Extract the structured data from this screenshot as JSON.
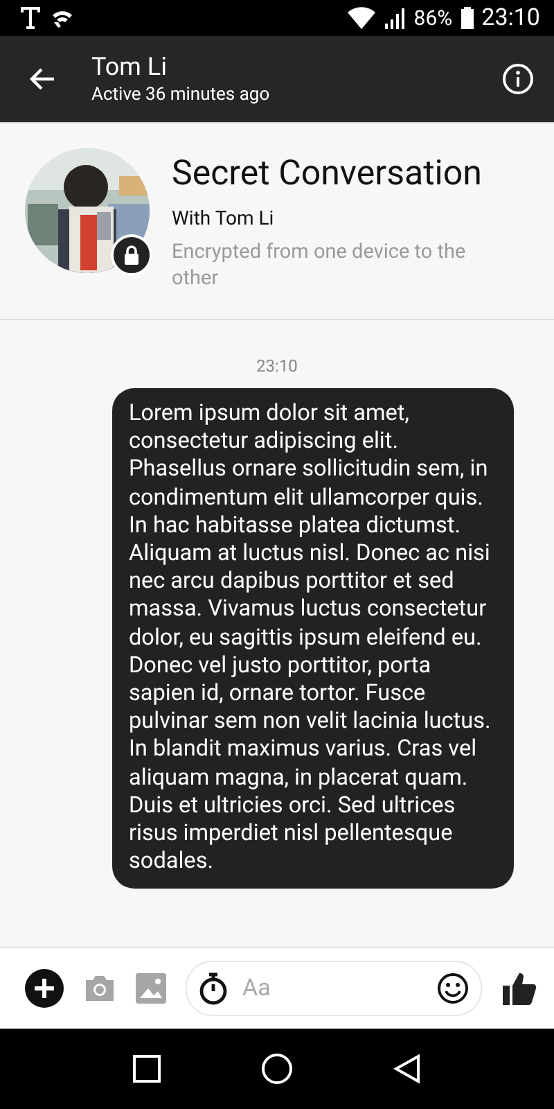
{
  "status_bar": {
    "battery": "86%",
    "time": "23:10"
  },
  "header": {
    "name": "Tom Li",
    "status": "Active 36 minutes ago"
  },
  "intro": {
    "title": "Secret Conversation",
    "with": "With Tom Li",
    "note": "Encrypted from one device to the other"
  },
  "messages": [
    {
      "kind": "timestamp",
      "text": "23:10"
    },
    {
      "kind": "sent",
      "text": "Lorem ipsum dolor sit amet, consectetur adipiscing elit. Phasellus ornare sollicitudin sem, in condimentum elit ullamcorper quis. In hac habitasse platea dictumst. Aliquam at luctus nisl. Donec ac nisi nec arcu dapibus porttitor et sed massa. Vivamus luctus consectetur dolor, eu sagittis ipsum eleifend eu. Donec vel justo porttitor, porta sapien id, ornare tortor. Fusce pulvinar sem non velit lacinia luctus. In blandit maximus varius. Cras vel aliquam magna, in placerat quam. Duis et ultricies orci. Sed ultrices risus imperdiet nisl pellentesque sodales."
    }
  ],
  "composer": {
    "placeholder": "Aa"
  }
}
